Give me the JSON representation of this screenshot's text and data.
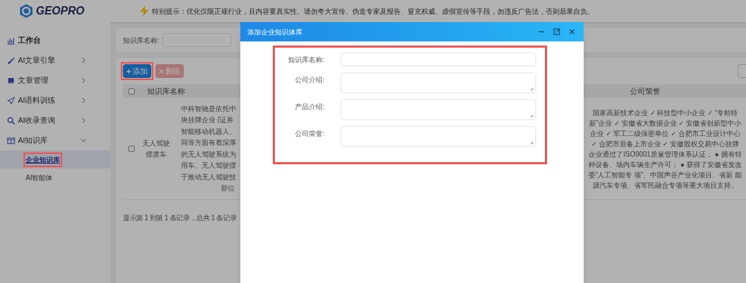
{
  "header": {
    "logo": "GEOPRO",
    "notice": "特别提示：优化仅限正规行业，且内容要真实性。请勿夸大宣传、伪造专家及报告、冒充权威、虚假宣传等手段，勿违反广告法，否则后果自负。"
  },
  "sidebar": {
    "items": [
      {
        "label": "工作台"
      },
      {
        "label": "AI文章引擎",
        "expanded": false
      },
      {
        "label": "文章管理",
        "expanded": false
      },
      {
        "label": "AI语料训练",
        "expanded": false
      },
      {
        "label": "AI收录查询",
        "expanded": false
      },
      {
        "label": "AI知识库",
        "expanded": true,
        "children": [
          {
            "label": "企业知识库",
            "selected": true,
            "highlighted": true
          },
          {
            "label": "AI智能体",
            "selected": false,
            "highlighted": false
          }
        ]
      }
    ]
  },
  "filter": {
    "label": "知识库名称:"
  },
  "toolbar": {
    "buttons": [
      {
        "label": "添加",
        "kind": "add",
        "disabled": false,
        "highlighted": true
      },
      {
        "label": "删除",
        "kind": "delete",
        "disabled": true,
        "highlighted": false
      }
    ]
  },
  "table": {
    "all_checked": false,
    "columns": [
      "知识库名称",
      "公司荣誉"
    ],
    "rows": [
      {
        "checked": false,
        "name": "无人驾驶摆渡车",
        "intro_lines": [
          "中科智驰是依托中",
          "块挂牌企业 (证券",
          "智能移动机器人、",
          "同等方面有着深厚",
          "的无人驾驶系统为",
          "用车、无人驾驶摆",
          "于推动无人驾驶技",
          "部位"
        ],
        "honors": "国家高新技术企业 ✓ 科技型中小企业 ✓ “专精特新”企业 ✓ 安徽省大数据企业 ✓ 安徽省创新型中小企业 ✓ 军工二级保密单位 ✓ 合肥市工业设计中心 ✓ 合肥市后备上市企业 ✓ 安徽股权交易中心挂牌企业通过了ISO9001质量管理体系认证； ● 拥有特种设备、场内车辆生产许可； ● 获得了安徽省发改委“人工智能专 项”、中国声谷产业化项目、省新 能源汽车专项、省军民融合专项等重大项目支持。"
      }
    ],
    "footer": "显示第 1 到第 1 条记录，总共 1 条记录"
  },
  "dialog": {
    "title": "添加企业知识体库",
    "highlighted": true,
    "fields": [
      {
        "label": "知识库名称:",
        "kind": "input"
      },
      {
        "label": "公司介绍:",
        "kind": "textarea"
      },
      {
        "label": "产品介绍:",
        "kind": "textarea"
      },
      {
        "label": "公司荣誉:",
        "kind": "textarea"
      }
    ]
  }
}
